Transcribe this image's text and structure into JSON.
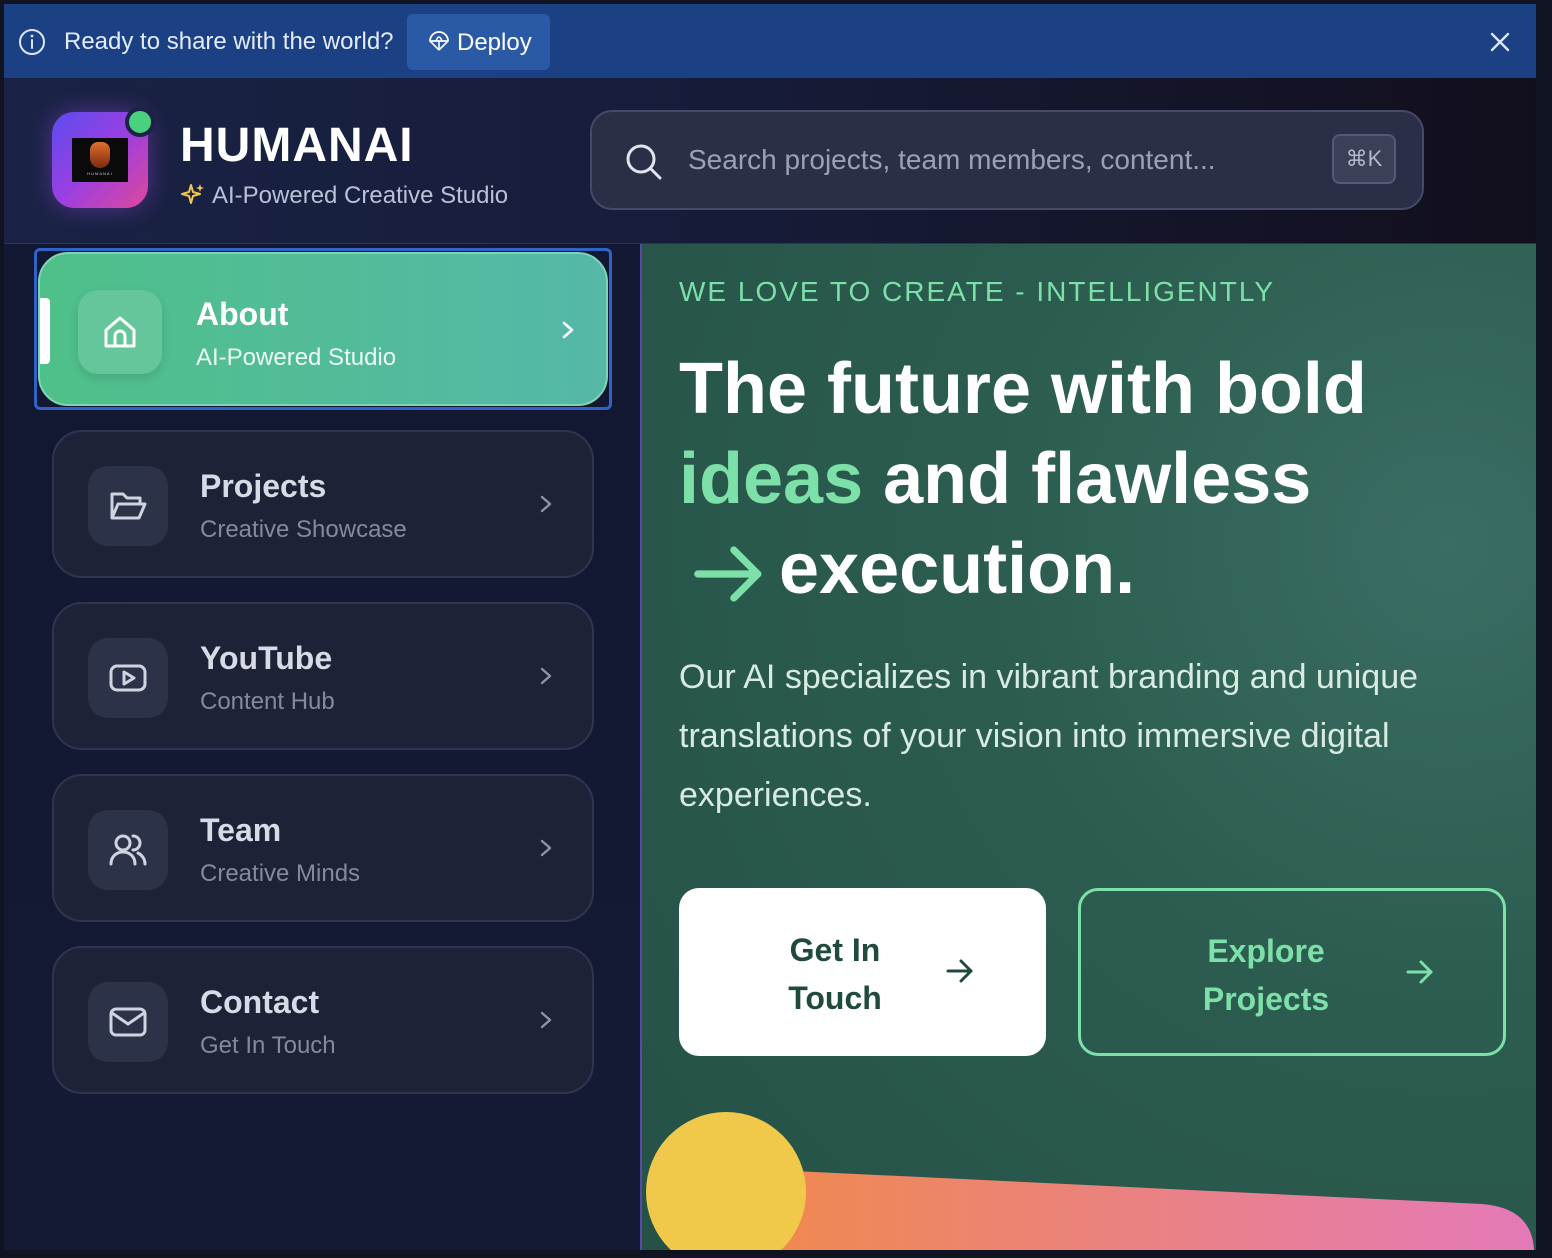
{
  "banner": {
    "message": "Ready to share with the world?",
    "deploy_label": "Deploy",
    "colors": {
      "background": "#1b4184",
      "button": "#2a5aa5"
    }
  },
  "header": {
    "brand": "HUMANAI",
    "tagline": "AI-Powered Creative Studio",
    "logo_caption": "HUMANAI",
    "search_placeholder": "Search projects, team members, content...",
    "shortcut": "⌘K"
  },
  "sidebar": {
    "items": [
      {
        "title": "About",
        "subtitle": "AI-Powered Studio",
        "icon": "home-icon",
        "active": true
      },
      {
        "title": "Projects",
        "subtitle": "Creative Showcase",
        "icon": "folder-open-icon",
        "active": false
      },
      {
        "title": "YouTube",
        "subtitle": "Content Hub",
        "icon": "video-play-icon",
        "active": false
      },
      {
        "title": "Team",
        "subtitle": "Creative Minds",
        "icon": "users-icon",
        "active": false
      },
      {
        "title": "Contact",
        "subtitle": "Get In Touch",
        "icon": "mail-icon",
        "active": false
      }
    ]
  },
  "hero": {
    "eyebrow": "WE LOVE TO CREATE - INTELLIGENTLY",
    "headline_part1": "The future with bold",
    "headline_accent": "ideas",
    "headline_part2": "and flawless",
    "headline_part3": "execution.",
    "description": "Our AI specializes in vibrant branding and unique translations of your vision into immersive digital experiences.",
    "cta_primary": "Get In Touch",
    "cta_secondary": "Explore Projects"
  },
  "colors": {
    "accent_green": "#7ce0a8",
    "active_nav_start": "#4fc089",
    "active_nav_end": "#55b8a8",
    "online_indicator": "#4ad17d",
    "sidebar_bg": "#121832",
    "hero_bg": "#2c5d50"
  }
}
